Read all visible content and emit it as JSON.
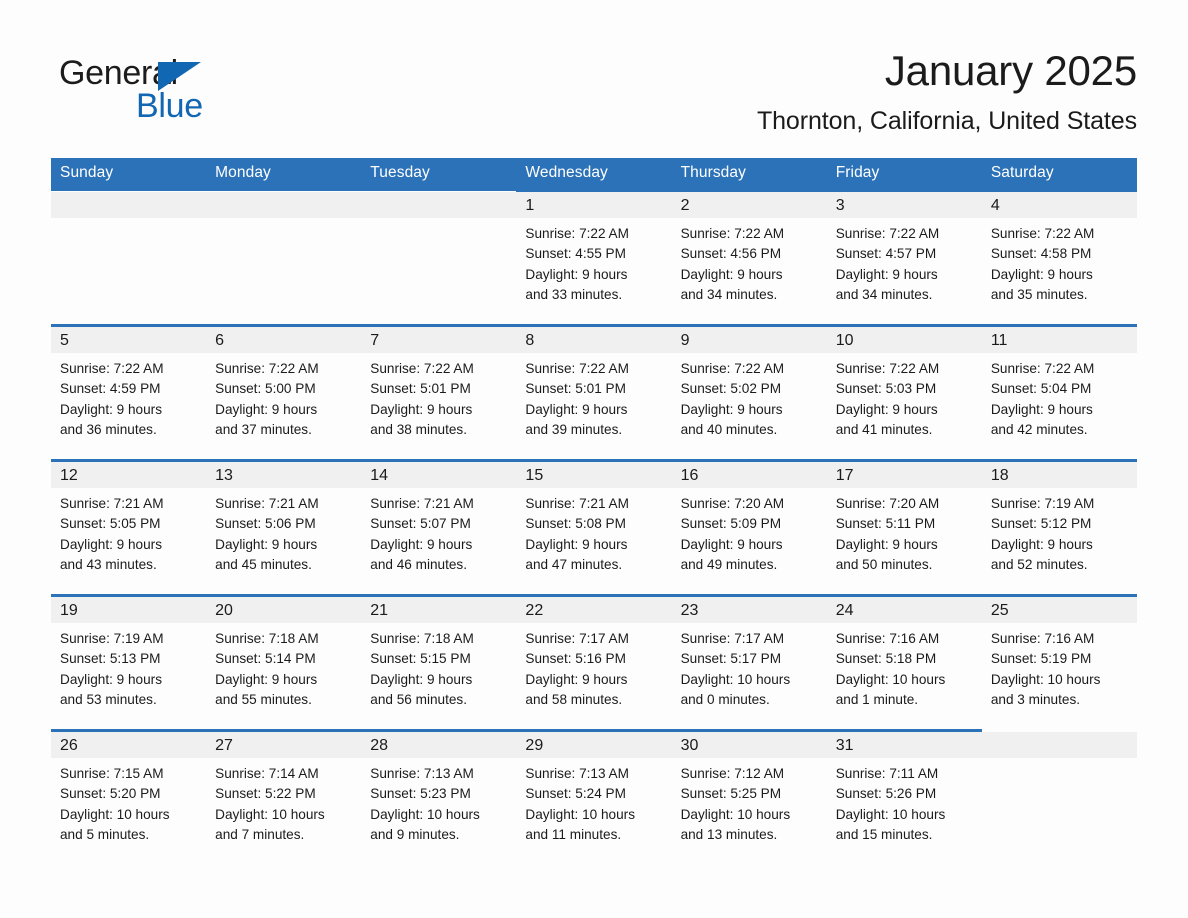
{
  "brand": {
    "name_part1": "General",
    "name_part2": "Blue",
    "flag_icon": "triangle-flag-icon",
    "accent_color": "#1267b3"
  },
  "header": {
    "title": "January 2025",
    "subtitle": "Thornton, California, United States"
  },
  "theme": {
    "header_blue": "#2c72b8",
    "row_band_gray": "#f0f0f0",
    "page_background": "#fdfdfd",
    "text_color": "#1b1b1b"
  },
  "weekday_headers": [
    "Sunday",
    "Monday",
    "Tuesday",
    "Wednesday",
    "Thursday",
    "Friday",
    "Saturday"
  ],
  "weeks": [
    [
      {
        "day": "",
        "lines": []
      },
      {
        "day": "",
        "lines": []
      },
      {
        "day": "",
        "lines": []
      },
      {
        "day": "1",
        "lines": [
          "Sunrise: 7:22 AM",
          "Sunset: 4:55 PM",
          "Daylight: 9 hours",
          "and 33 minutes."
        ]
      },
      {
        "day": "2",
        "lines": [
          "Sunrise: 7:22 AM",
          "Sunset: 4:56 PM",
          "Daylight: 9 hours",
          "and 34 minutes."
        ]
      },
      {
        "day": "3",
        "lines": [
          "Sunrise: 7:22 AM",
          "Sunset: 4:57 PM",
          "Daylight: 9 hours",
          "and 34 minutes."
        ]
      },
      {
        "day": "4",
        "lines": [
          "Sunrise: 7:22 AM",
          "Sunset: 4:58 PM",
          "Daylight: 9 hours",
          "and 35 minutes."
        ]
      }
    ],
    [
      {
        "day": "5",
        "lines": [
          "Sunrise: 7:22 AM",
          "Sunset: 4:59 PM",
          "Daylight: 9 hours",
          "and 36 minutes."
        ]
      },
      {
        "day": "6",
        "lines": [
          "Sunrise: 7:22 AM",
          "Sunset: 5:00 PM",
          "Daylight: 9 hours",
          "and 37 minutes."
        ]
      },
      {
        "day": "7",
        "lines": [
          "Sunrise: 7:22 AM",
          "Sunset: 5:01 PM",
          "Daylight: 9 hours",
          "and 38 minutes."
        ]
      },
      {
        "day": "8",
        "lines": [
          "Sunrise: 7:22 AM",
          "Sunset: 5:01 PM",
          "Daylight: 9 hours",
          "and 39 minutes."
        ]
      },
      {
        "day": "9",
        "lines": [
          "Sunrise: 7:22 AM",
          "Sunset: 5:02 PM",
          "Daylight: 9 hours",
          "and 40 minutes."
        ]
      },
      {
        "day": "10",
        "lines": [
          "Sunrise: 7:22 AM",
          "Sunset: 5:03 PM",
          "Daylight: 9 hours",
          "and 41 minutes."
        ]
      },
      {
        "day": "11",
        "lines": [
          "Sunrise: 7:22 AM",
          "Sunset: 5:04 PM",
          "Daylight: 9 hours",
          "and 42 minutes."
        ]
      }
    ],
    [
      {
        "day": "12",
        "lines": [
          "Sunrise: 7:21 AM",
          "Sunset: 5:05 PM",
          "Daylight: 9 hours",
          "and 43 minutes."
        ]
      },
      {
        "day": "13",
        "lines": [
          "Sunrise: 7:21 AM",
          "Sunset: 5:06 PM",
          "Daylight: 9 hours",
          "and 45 minutes."
        ]
      },
      {
        "day": "14",
        "lines": [
          "Sunrise: 7:21 AM",
          "Sunset: 5:07 PM",
          "Daylight: 9 hours",
          "and 46 minutes."
        ]
      },
      {
        "day": "15",
        "lines": [
          "Sunrise: 7:21 AM",
          "Sunset: 5:08 PM",
          "Daylight: 9 hours",
          "and 47 minutes."
        ]
      },
      {
        "day": "16",
        "lines": [
          "Sunrise: 7:20 AM",
          "Sunset: 5:09 PM",
          "Daylight: 9 hours",
          "and 49 minutes."
        ]
      },
      {
        "day": "17",
        "lines": [
          "Sunrise: 7:20 AM",
          "Sunset: 5:11 PM",
          "Daylight: 9 hours",
          "and 50 minutes."
        ]
      },
      {
        "day": "18",
        "lines": [
          "Sunrise: 7:19 AM",
          "Sunset: 5:12 PM",
          "Daylight: 9 hours",
          "and 52 minutes."
        ]
      }
    ],
    [
      {
        "day": "19",
        "lines": [
          "Sunrise: 7:19 AM",
          "Sunset: 5:13 PM",
          "Daylight: 9 hours",
          "and 53 minutes."
        ]
      },
      {
        "day": "20",
        "lines": [
          "Sunrise: 7:18 AM",
          "Sunset: 5:14 PM",
          "Daylight: 9 hours",
          "and 55 minutes."
        ]
      },
      {
        "day": "21",
        "lines": [
          "Sunrise: 7:18 AM",
          "Sunset: 5:15 PM",
          "Daylight: 9 hours",
          "and 56 minutes."
        ]
      },
      {
        "day": "22",
        "lines": [
          "Sunrise: 7:17 AM",
          "Sunset: 5:16 PM",
          "Daylight: 9 hours",
          "and 58 minutes."
        ]
      },
      {
        "day": "23",
        "lines": [
          "Sunrise: 7:17 AM",
          "Sunset: 5:17 PM",
          "Daylight: 10 hours",
          "and 0 minutes."
        ]
      },
      {
        "day": "24",
        "lines": [
          "Sunrise: 7:16 AM",
          "Sunset: 5:18 PM",
          "Daylight: 10 hours",
          "and 1 minute."
        ]
      },
      {
        "day": "25",
        "lines": [
          "Sunrise: 7:16 AM",
          "Sunset: 5:19 PM",
          "Daylight: 10 hours",
          "and 3 minutes."
        ]
      }
    ],
    [
      {
        "day": "26",
        "lines": [
          "Sunrise: 7:15 AM",
          "Sunset: 5:20 PM",
          "Daylight: 10 hours",
          "and 5 minutes."
        ]
      },
      {
        "day": "27",
        "lines": [
          "Sunrise: 7:14 AM",
          "Sunset: 5:22 PM",
          "Daylight: 10 hours",
          "and 7 minutes."
        ]
      },
      {
        "day": "28",
        "lines": [
          "Sunrise: 7:13 AM",
          "Sunset: 5:23 PM",
          "Daylight: 10 hours",
          "and 9 minutes."
        ]
      },
      {
        "day": "29",
        "lines": [
          "Sunrise: 7:13 AM",
          "Sunset: 5:24 PM",
          "Daylight: 10 hours",
          "and 11 minutes."
        ]
      },
      {
        "day": "30",
        "lines": [
          "Sunrise: 7:12 AM",
          "Sunset: 5:25 PM",
          "Daylight: 10 hours",
          "and 13 minutes."
        ]
      },
      {
        "day": "31",
        "lines": [
          "Sunrise: 7:11 AM",
          "Sunset: 5:26 PM",
          "Daylight: 10 hours",
          "and 15 minutes."
        ]
      },
      {
        "day": "",
        "lines": []
      }
    ]
  ]
}
